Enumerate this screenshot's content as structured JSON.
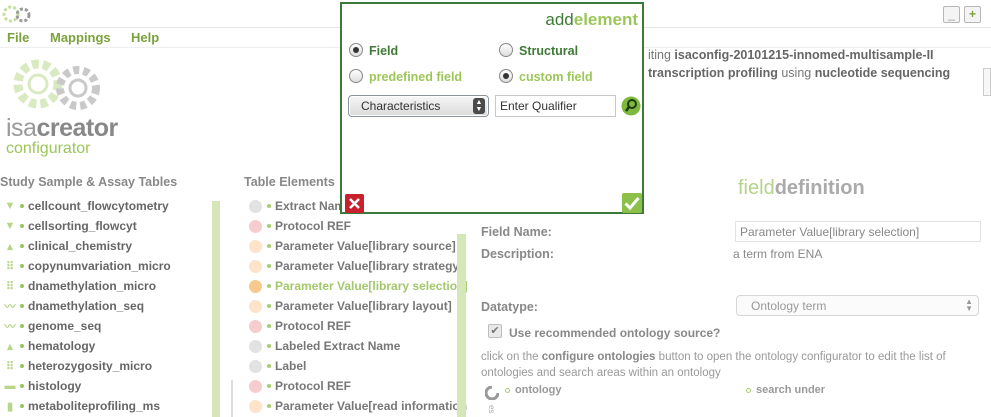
{
  "window": {
    "minimize_icon": "minimize-icon",
    "maximize_label": "+"
  },
  "menu": {
    "items": [
      "File",
      "Mappings",
      "Help"
    ]
  },
  "brand": {
    "name_light": "isa",
    "name_bold": "creator",
    "subtitle": "configurator"
  },
  "study_tables": {
    "heading": "Study Sample & Assay Tables",
    "items": [
      {
        "label": "cellcount_flowcytometry",
        "icon": "funnel-icon"
      },
      {
        "label": "cellsorting_flowcyt",
        "icon": "funnel-icon"
      },
      {
        "label": "clinical_chemistry",
        "icon": "flask-icon"
      },
      {
        "label": "copynumvariation_micro",
        "icon": "grid-icon"
      },
      {
        "label": "dnamethylation_micro",
        "icon": "grid-icon"
      },
      {
        "label": "dnamethylation_seq",
        "icon": "wave-icon"
      },
      {
        "label": "genome_seq",
        "icon": "wave-icon"
      },
      {
        "label": "hematology",
        "icon": "flask-icon"
      },
      {
        "label": "heterozygosity_micro",
        "icon": "grid-icon"
      },
      {
        "label": "histology",
        "icon": "slide-icon"
      },
      {
        "label": "metaboliteprofiling_ms",
        "icon": "bars-icon"
      }
    ]
  },
  "table_elements": {
    "heading": "Table Elements",
    "items": [
      {
        "label": "Extract Name",
        "color": "#e2e2e2"
      },
      {
        "label": "Protocol REF",
        "color": "#f6cccc"
      },
      {
        "label": "Parameter Value[library source]",
        "color": "#fde3c8"
      },
      {
        "label": "Parameter Value[library strategy]",
        "color": "#fde3c8"
      },
      {
        "label": "Parameter Value[library selection]",
        "color": "#f8c98f",
        "selected": true
      },
      {
        "label": "Parameter Value[library layout]",
        "color": "#fde3c8"
      },
      {
        "label": "Protocol REF",
        "color": "#f6cccc"
      },
      {
        "label": "Labeled Extract Name",
        "color": "#e2e2e2"
      },
      {
        "label": "Label",
        "color": "#e2e2e2"
      },
      {
        "label": "Protocol REF",
        "color": "#f6cccc"
      },
      {
        "label": "Parameter Value[read information]",
        "color": "#fde3c8"
      }
    ]
  },
  "editing": {
    "line1_prefix": "iting",
    "line1_config": "isaconfig-20101215-innomed-multisample-II",
    "line2_assay": "transcription profiling",
    "line2_using": "using",
    "line2_tech": "nucleotide sequencing"
  },
  "field_definition": {
    "title_light": "field",
    "title_bold": "definition",
    "field_name_label": "Field Name:",
    "field_name_value": "Parameter Value[library selection]",
    "description_label": "Description:",
    "description_value": "a term from ENA",
    "datatype_label": "Datatype:",
    "datatype_value": "Ontology term",
    "use_recommended_label": "Use recommended ontology source?",
    "use_recommended_checked": true,
    "help_prefix": "click on the",
    "help_bold": "configure ontologies",
    "help_suffix": "button to open the ontology configurator to edit the list of ontologies and search areas within an ontology",
    "ontology_col": "ontology",
    "search_under_col": "search under",
    "partial_text": "es"
  },
  "dialog": {
    "title_light": "add",
    "title_bold": "element",
    "options": {
      "field": "Field",
      "structural": "Structural",
      "predefined": "predefined field",
      "custom": "custom field"
    },
    "field_selected": true,
    "custom_selected": true,
    "select_value": "Characteristics",
    "qualifier_placeholder": "Enter Qualifier"
  },
  "colors": {
    "accent_green": "#9cc65a",
    "dark_green": "#3f7a37",
    "close_red": "#c8202c"
  }
}
